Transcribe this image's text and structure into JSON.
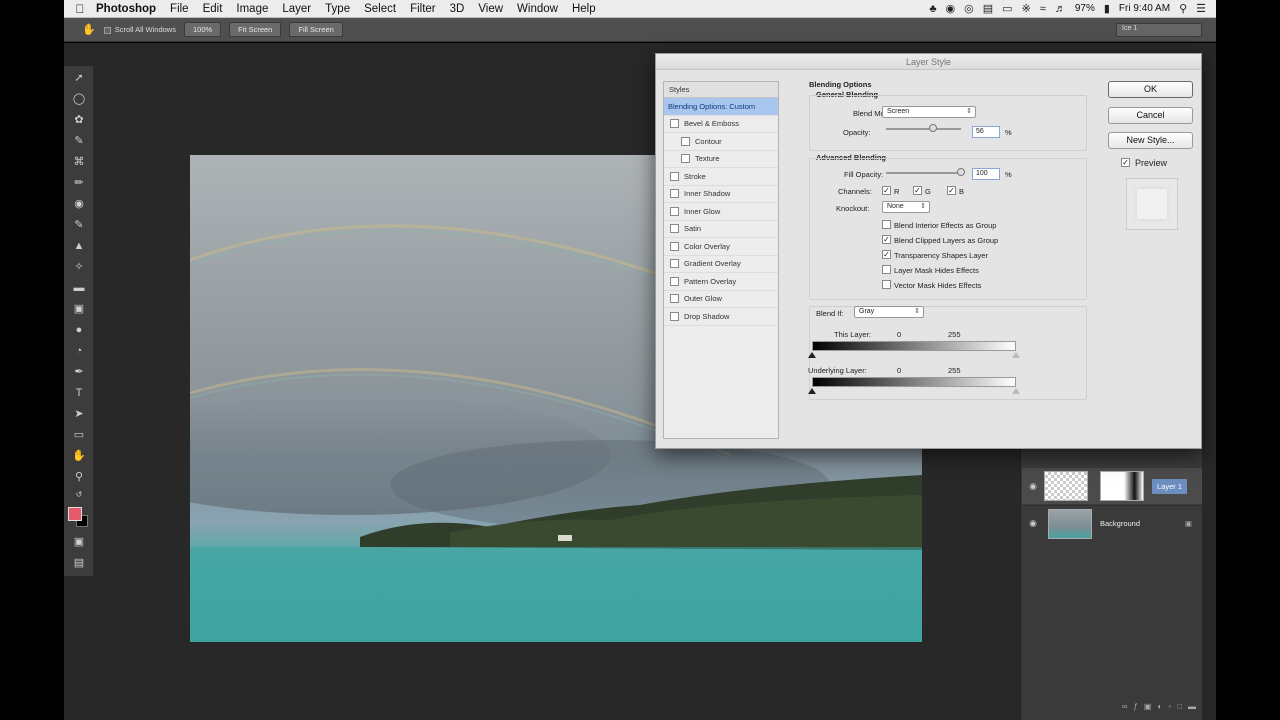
{
  "menubar": {
    "app_name": "Photoshop",
    "items": [
      "File",
      "Edit",
      "Image",
      "Layer",
      "Type",
      "Select",
      "Filter",
      "3D",
      "View",
      "Window",
      "Help"
    ],
    "battery": "97%",
    "time": "Fri 9:40 AM"
  },
  "options": {
    "scroll_all": "Scroll All Windows",
    "zoom_100": "100%",
    "fit_screen": "Fit Screen",
    "fill_screen": "Fill Screen",
    "workspace": "Ice 1"
  },
  "layers": {
    "layer1_name": "Layer 1",
    "background_name": "Background"
  },
  "dialog": {
    "title": "Layer Style",
    "styles_header": "Styles",
    "styles": [
      {
        "label": "Blending Options: Custom",
        "checkbox": false,
        "selected": true,
        "indent": 0
      },
      {
        "label": "Bevel & Emboss",
        "checkbox": true,
        "selected": false,
        "indent": 0
      },
      {
        "label": "Contour",
        "checkbox": true,
        "selected": false,
        "indent": 1
      },
      {
        "label": "Texture",
        "checkbox": true,
        "selected": false,
        "indent": 1
      },
      {
        "label": "Stroke",
        "checkbox": true,
        "selected": false,
        "indent": 0
      },
      {
        "label": "Inner Shadow",
        "checkbox": true,
        "selected": false,
        "indent": 0
      },
      {
        "label": "Inner Glow",
        "checkbox": true,
        "selected": false,
        "indent": 0
      },
      {
        "label": "Satin",
        "checkbox": true,
        "selected": false,
        "indent": 0
      },
      {
        "label": "Color Overlay",
        "checkbox": true,
        "selected": false,
        "indent": 0
      },
      {
        "label": "Gradient Overlay",
        "checkbox": true,
        "selected": false,
        "indent": 0
      },
      {
        "label": "Pattern Overlay",
        "checkbox": true,
        "selected": false,
        "indent": 0
      },
      {
        "label": "Outer Glow",
        "checkbox": true,
        "selected": false,
        "indent": 0
      },
      {
        "label": "Drop Shadow",
        "checkbox": true,
        "selected": false,
        "indent": 0
      }
    ],
    "blending_options_title": "Blending Options",
    "general_blending_title": "General Blending",
    "blend_mode_label": "Blend Mode:",
    "blend_mode_value": "Screen",
    "opacity_label": "Opacity:",
    "opacity_value": "56",
    "opacity_fraction": 0.62,
    "percent": "%",
    "advanced_blending_title": "Advanced Blending",
    "fill_opacity_label": "Fill Opacity:",
    "fill_opacity_value": "100",
    "fill_opacity_fraction": 1.0,
    "channels_label": "Channels:",
    "channel_r": "R",
    "channel_g": "G",
    "channel_b": "B",
    "knockout_label": "Knockout:",
    "knockout_value": "None",
    "adv_options": [
      {
        "label": "Blend Interior Effects as Group",
        "checked": false
      },
      {
        "label": "Blend Clipped Layers as Group",
        "checked": true
      },
      {
        "label": "Transparency Shapes Layer",
        "checked": true
      },
      {
        "label": "Layer Mask Hides Effects",
        "checked": false
      },
      {
        "label": "Vector Mask Hides Effects",
        "checked": false
      }
    ],
    "blend_if_label": "Blend If:",
    "blend_if_value": "Gray",
    "this_layer_label": "This Layer:",
    "underlying_layer_label": "Underlying Layer:",
    "range_min": "0",
    "range_max": "255",
    "ok_label": "OK",
    "cancel_label": "Cancel",
    "new_style_label": "New Style...",
    "preview_label": "Preview",
    "check_glyph": "✓"
  }
}
